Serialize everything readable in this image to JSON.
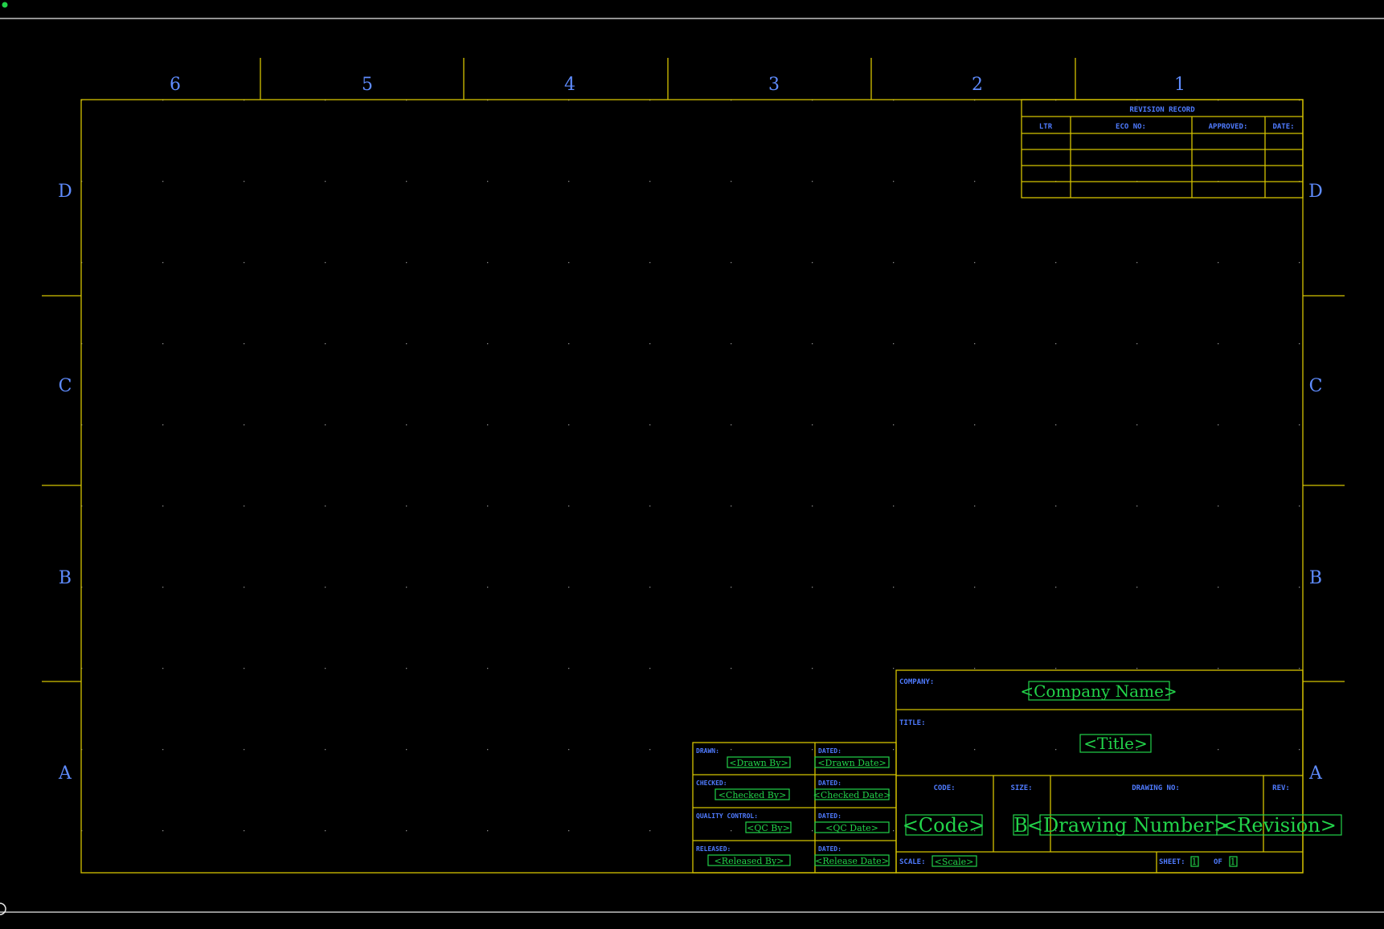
{
  "colors": {
    "background": "#000000",
    "border": "#d4c200",
    "label_text": "#5f8cff",
    "placeholder_text": "#22d34a",
    "scroll_line": "#eaeaea"
  },
  "zones": {
    "columns": [
      "6",
      "5",
      "4",
      "3",
      "2",
      "1"
    ],
    "rows": [
      "D",
      "C",
      "B",
      "A"
    ]
  },
  "revision_block": {
    "title": "REVISION RECORD",
    "headers": [
      "LTR",
      "ECO NO:",
      "APPROVED:",
      "DATE:"
    ]
  },
  "title_block": {
    "company_label": "COMPANY:",
    "company_value": "<Company Name>",
    "title_label": "TITLE:",
    "title_value": "<Title>",
    "code_label": "CODE:",
    "code_value": "<Code>",
    "size_label": "SIZE:",
    "size_value": "B",
    "drawing_no_label": "DRAWING NO:",
    "drawing_no_value": "<Drawing Number>",
    "rev_label": "REV:",
    "rev_value": "<Revision>",
    "scale_label": "SCALE:",
    "scale_value": "<Scale>",
    "sheet_label": "SHEET:",
    "sheet_value": "1",
    "of_label": "OF",
    "of_value": "1"
  },
  "signoff": [
    {
      "label": "DRAWN:",
      "value": "<Drawn By>",
      "date_label": "DATED:",
      "date_value": "<Drawn Date>"
    },
    {
      "label": "CHECKED:",
      "value": "<Checked By>",
      "date_label": "DATED:",
      "date_value": "<Checked Date>"
    },
    {
      "label": "QUALITY CONTROL:",
      "value": "<QC By>",
      "date_label": "DATED:",
      "date_value": "<QC Date>"
    },
    {
      "label": "RELEASED:",
      "value": "<Released By>",
      "date_label": "DATED:",
      "date_value": "<Release Date>"
    }
  ]
}
